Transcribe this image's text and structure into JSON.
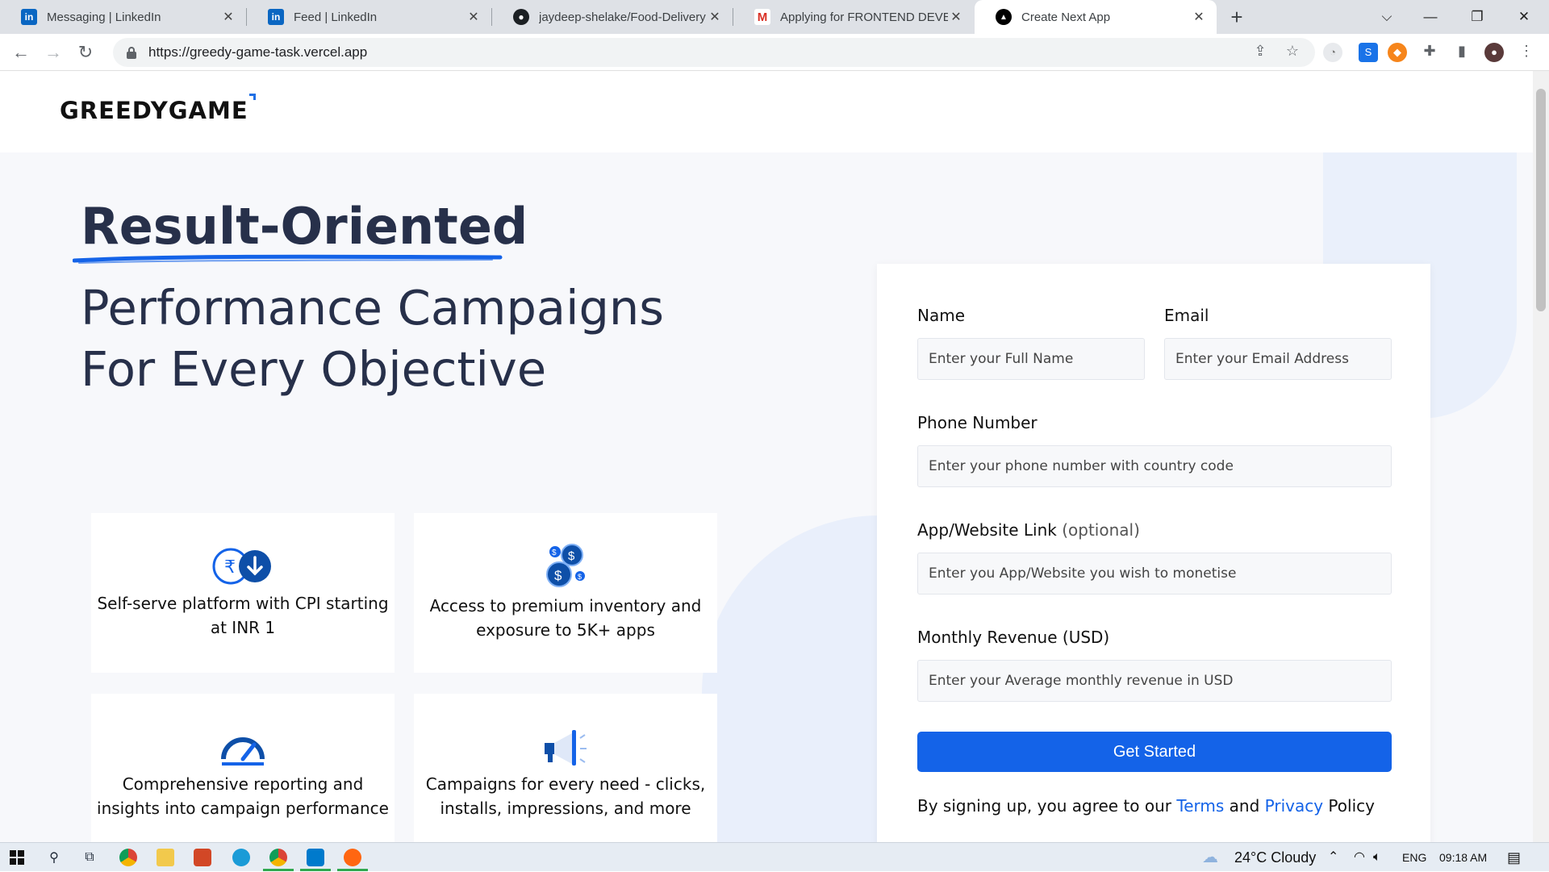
{
  "browser": {
    "tabs": [
      {
        "title": "Messaging | LinkedIn",
        "icon": "linkedin-icon"
      },
      {
        "title": "Feed | LinkedIn",
        "icon": "linkedin-icon"
      },
      {
        "title": "jaydeep-shelake/Food-Delivery: F",
        "icon": "github-icon"
      },
      {
        "title": "Applying for FRONTEND DEVELO",
        "icon": "gmail-icon"
      },
      {
        "title": "Create Next App",
        "icon": "nextjs-icon"
      }
    ],
    "new_tab": "+",
    "url": "https://greedy-game-task.vercel.app"
  },
  "page": {
    "logo": "GREEDYGAME",
    "headline_main": "Result-Oriented",
    "headline_line2": "Performance Campaigns",
    "headline_line3": "For Every Objective",
    "features": [
      {
        "text": "Self-serve platform with CPI starting at INR 1",
        "icon": "rupee-download-icon"
      },
      {
        "text": "Access to premium inventory and exposure to 5K+ apps",
        "icon": "coins-icon"
      },
      {
        "text": "Comprehensive reporting and insights into campaign performance",
        "icon": "speedometer-icon"
      },
      {
        "text": "Campaigns for every need - clicks, installs, impressions, and more",
        "icon": "megaphone-icon"
      }
    ]
  },
  "form": {
    "name_label": "Name",
    "name_placeholder": "Enter your Full Name",
    "email_label": "Email",
    "email_placeholder": "Enter your Email Address",
    "phone_label": "Phone Number",
    "phone_placeholder": "Enter your phone number with country code",
    "link_label": "App/Website Link",
    "link_optional": "(optional)",
    "link_placeholder": "Enter you App/Website you wish to monetise",
    "revenue_label": "Monthly Revenue (USD)",
    "revenue_placeholder": "Enter your Average monthly revenue in USD",
    "submit": "Get Started",
    "agree_prefix": "By signing up, you agree to our",
    "terms": "Terms",
    "and": "and",
    "privacy": "Privacy",
    "policy": "Policy"
  },
  "taskbar": {
    "weather": "24°C  Cloudy",
    "lang": "ENG",
    "time": "09:18 AM"
  },
  "colors": {
    "accent": "#1463e8",
    "heading": "#27304a",
    "hero_bg": "#f7f8fb"
  }
}
